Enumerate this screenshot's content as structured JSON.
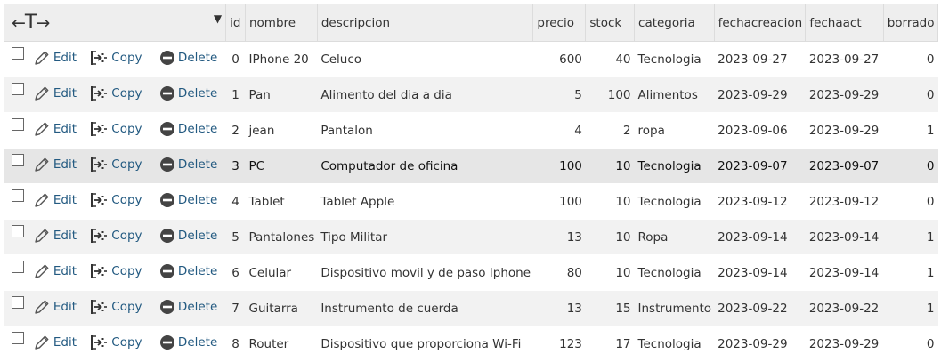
{
  "header": {
    "column_arrows_left": "←",
    "column_arrows_t": "T",
    "column_arrows_right": "→",
    "sort_indicator": "▼",
    "columns": [
      "id",
      "nombre",
      "descripcion",
      "precio",
      "stock",
      "categoria",
      "fechacreacion",
      "fechaact",
      "borrado"
    ]
  },
  "actions": {
    "edit": "Edit",
    "copy": "Copy",
    "delete": "Delete"
  },
  "icons": {
    "edit": "pencil-icon",
    "copy": "copy-icon",
    "delete": "delete-icon"
  },
  "colors": {
    "link": "#235a81",
    "header_bg": "#eeeeee",
    "row_alt": "#f2f2f2",
    "row_highlight": "#e6e6e6"
  },
  "rows": [
    {
      "id": "0",
      "nombre": "IPhone 20",
      "descripcion": "Celuco",
      "precio": "600",
      "stock": "40",
      "categoria": "Tecnologia",
      "fechacreacion": "2023-09-27",
      "fechaact": "2023-09-27",
      "borrado": "0"
    },
    {
      "id": "1",
      "nombre": "Pan",
      "descripcion": "Alimento del dia a dia",
      "precio": "5",
      "stock": "100",
      "categoria": "Alimentos",
      "fechacreacion": "2023-09-29",
      "fechaact": "2023-09-29",
      "borrado": "0"
    },
    {
      "id": "2",
      "nombre": "jean",
      "descripcion": "Pantalon",
      "precio": "4",
      "stock": "2",
      "categoria": "ropa",
      "fechacreacion": "2023-09-06",
      "fechaact": "2023-09-29",
      "borrado": "1"
    },
    {
      "id": "3",
      "nombre": "PC",
      "descripcion": "Computador de oficina",
      "precio": "100",
      "stock": "10",
      "categoria": "Tecnologia",
      "fechacreacion": "2023-09-07",
      "fechaact": "2023-09-07",
      "borrado": "0"
    },
    {
      "id": "4",
      "nombre": "Tablet",
      "descripcion": "Tablet Apple",
      "precio": "100",
      "stock": "10",
      "categoria": "Tecnologia",
      "fechacreacion": "2023-09-12",
      "fechaact": "2023-09-12",
      "borrado": "0"
    },
    {
      "id": "5",
      "nombre": "Pantalones",
      "descripcion": "Tipo Militar",
      "precio": "13",
      "stock": "10",
      "categoria": "Ropa",
      "fechacreacion": "2023-09-14",
      "fechaact": "2023-09-14",
      "borrado": "1"
    },
    {
      "id": "6",
      "nombre": "Celular",
      "descripcion": "Dispositivo movil y de paso Iphone",
      "precio": "80",
      "stock": "10",
      "categoria": "Tecnologia",
      "fechacreacion": "2023-09-14",
      "fechaact": "2023-09-14",
      "borrado": "1"
    },
    {
      "id": "7",
      "nombre": "Guitarra",
      "descripcion": "Instrumento de cuerda",
      "precio": "13",
      "stock": "15",
      "categoria": "Instrumento",
      "fechacreacion": "2023-09-22",
      "fechaact": "2023-09-22",
      "borrado": "1"
    },
    {
      "id": "8",
      "nombre": "Router",
      "descripcion": "Dispositivo que proporciona Wi-Fi",
      "precio": "123",
      "stock": "17",
      "categoria": "Tecnologia",
      "fechacreacion": "2023-09-29",
      "fechaact": "2023-09-29",
      "borrado": "0"
    }
  ]
}
